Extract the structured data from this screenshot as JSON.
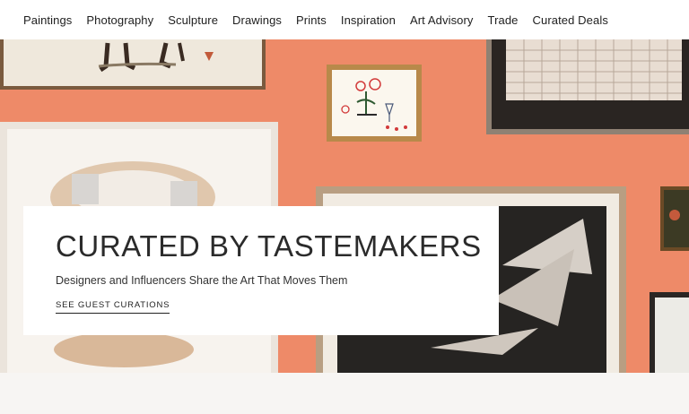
{
  "nav": {
    "items": [
      "Paintings",
      "Photography",
      "Sculpture",
      "Drawings",
      "Prints",
      "Inspiration",
      "Art Advisory",
      "Trade",
      "Curated Deals"
    ]
  },
  "hero": {
    "title": "CURATED BY TASTEMAKERS",
    "subtitle": "Designers and Influencers Share the Art That Moves Them",
    "cta_label": "SEE GUEST CURATIONS"
  },
  "colors": {
    "wall": "#ee8a68",
    "card": "#ffffff",
    "text": "#2b2b2b"
  }
}
